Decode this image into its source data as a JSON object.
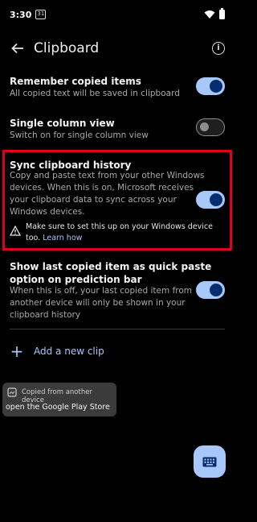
{
  "status": {
    "time": "3:30",
    "calendar_day": "31"
  },
  "appbar": {
    "title": "Clipboard"
  },
  "settings": {
    "remember": {
      "title": "Remember copied items",
      "desc": "All copied text will be saved in clipboard",
      "on": true
    },
    "single_column": {
      "title": "Single column view",
      "desc": "Switch on for single column view",
      "on": false
    },
    "sync": {
      "title": "Sync clipboard history",
      "desc_lines": [
        "Copy and paste text from your other Windows",
        "devices. When this is on, Microsoft receives",
        "your clipboard data to sync across your",
        "Windows devices."
      ],
      "warning_lines": [
        "Make sure to set this up on your Windows device",
        "too."
      ],
      "learn_more": "Learn how",
      "on": true
    },
    "show_last": {
      "title_lines": [
        "Show last copied item as quick paste",
        "option on prediction bar"
      ],
      "desc_lines": [
        "When this is off, your last copied item from",
        "another device will only be shown in your",
        "clipboard history"
      ],
      "on": true
    }
  },
  "add_clip": {
    "label": "Add a new clip"
  },
  "toast": {
    "source": "Copied from another device",
    "clip_text": "open the Google Play Store"
  },
  "colors": {
    "accent": "#a8c7fa",
    "highlight_border": "#e0001b",
    "background": "#000000"
  },
  "icons": [
    "back-arrow-icon",
    "info-icon",
    "warning-icon",
    "plus-icon",
    "keyboard-icon",
    "wifi-icon",
    "battery-icon"
  ]
}
